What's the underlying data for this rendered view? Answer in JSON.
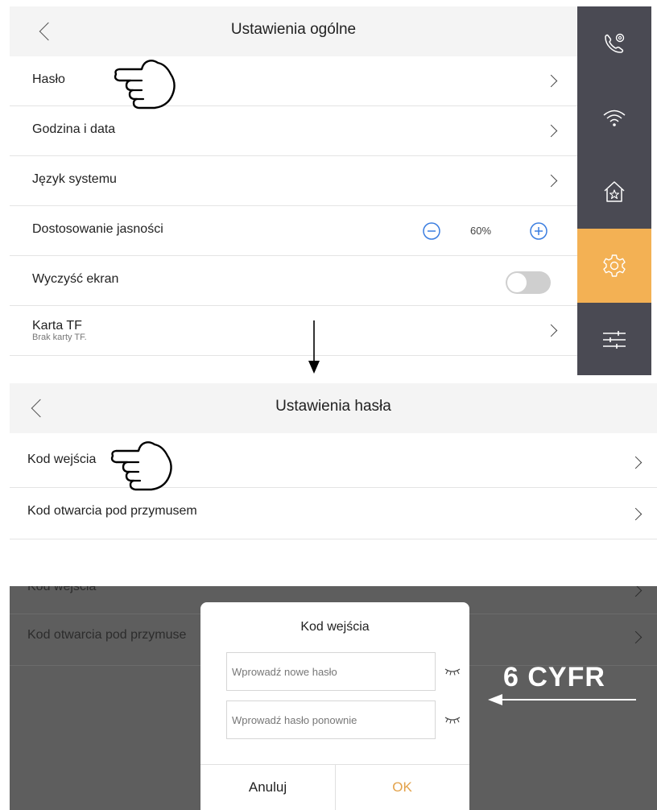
{
  "general_settings": {
    "title": "Ustawienia ogólne",
    "rows": [
      {
        "label": "Hasło"
      },
      {
        "label": "Godzina i data"
      },
      {
        "label": "Język systemu"
      },
      {
        "label": "Dostosowanie jasności",
        "value": "60%"
      },
      {
        "label": "Wyczyść ekran",
        "toggle": "off"
      },
      {
        "label": "Karta TF",
        "sub": "Brak karty TF."
      }
    ]
  },
  "sidebar": {
    "items": [
      {
        "icon": "phone-settings-icon"
      },
      {
        "icon": "wifi-icon"
      },
      {
        "icon": "home-star-icon"
      },
      {
        "icon": "gear-icon",
        "active": true
      },
      {
        "icon": "sliders-icon"
      }
    ],
    "active_color": "#f3b154",
    "background": "#4a4a53"
  },
  "password_settings": {
    "title": "Ustawienia hasła",
    "rows": [
      {
        "label": "Kod wejścia"
      },
      {
        "label": "Kod otwarcia pod przymusem"
      }
    ]
  },
  "dialog": {
    "background_rows": [
      "Kod wejścia",
      "Kod otwarcia pod przymuse"
    ],
    "title": "Kod wejścia",
    "new_password_placeholder": "Wprowadź nowe hasło",
    "repeat_password_placeholder": "Wprowadź hasło ponownie",
    "cancel_label": "Anuluj",
    "ok_label": "OK",
    "ok_color": "#e3a24a"
  },
  "annotation": "6 CYFR"
}
